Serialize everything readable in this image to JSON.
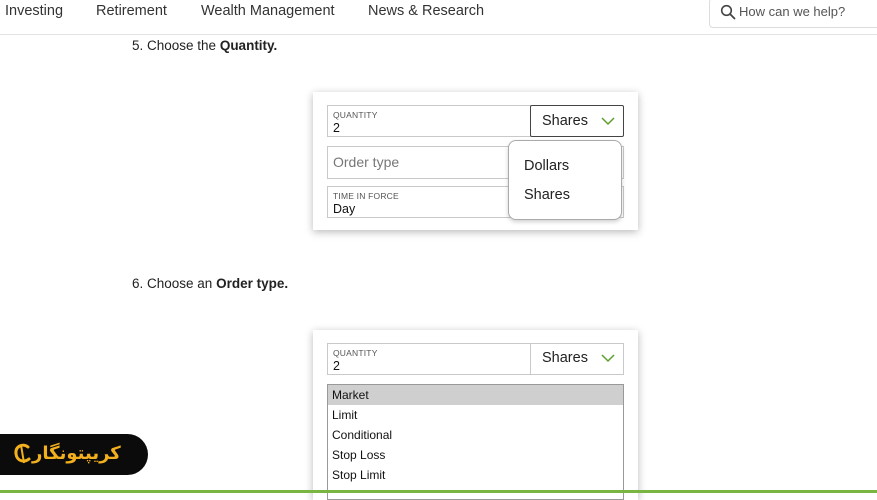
{
  "nav": {
    "items": [
      "Investing",
      "Retirement",
      "Wealth Management",
      "News & Research"
    ],
    "search_placeholder": "How can we help?"
  },
  "steps": [
    {
      "prefix": "5. Choose the ",
      "bold": "Quantity."
    },
    {
      "prefix": "6. Choose an ",
      "bold": "Order type."
    }
  ],
  "card1": {
    "quantity_label": "QUANTITY",
    "quantity_value": "2",
    "unit_value": "Shares",
    "order_type_placeholder": "Order type",
    "time_in_force_label": "TIME IN FORCE",
    "time_in_force_value": "Day",
    "unit_options": [
      "Dollars",
      "Shares"
    ]
  },
  "card2": {
    "quantity_label": "QUANTITY",
    "quantity_value": "2",
    "unit_value": "Shares",
    "order_types": [
      "Market",
      "Limit",
      "Conditional",
      "Stop Loss",
      "Stop Limit"
    ],
    "selected_order_type": "Market"
  },
  "watermark": {
    "text": "کریپتونگار"
  },
  "colors": {
    "accent_green": "#79b542",
    "watermark_gold": "#f2b01e"
  }
}
